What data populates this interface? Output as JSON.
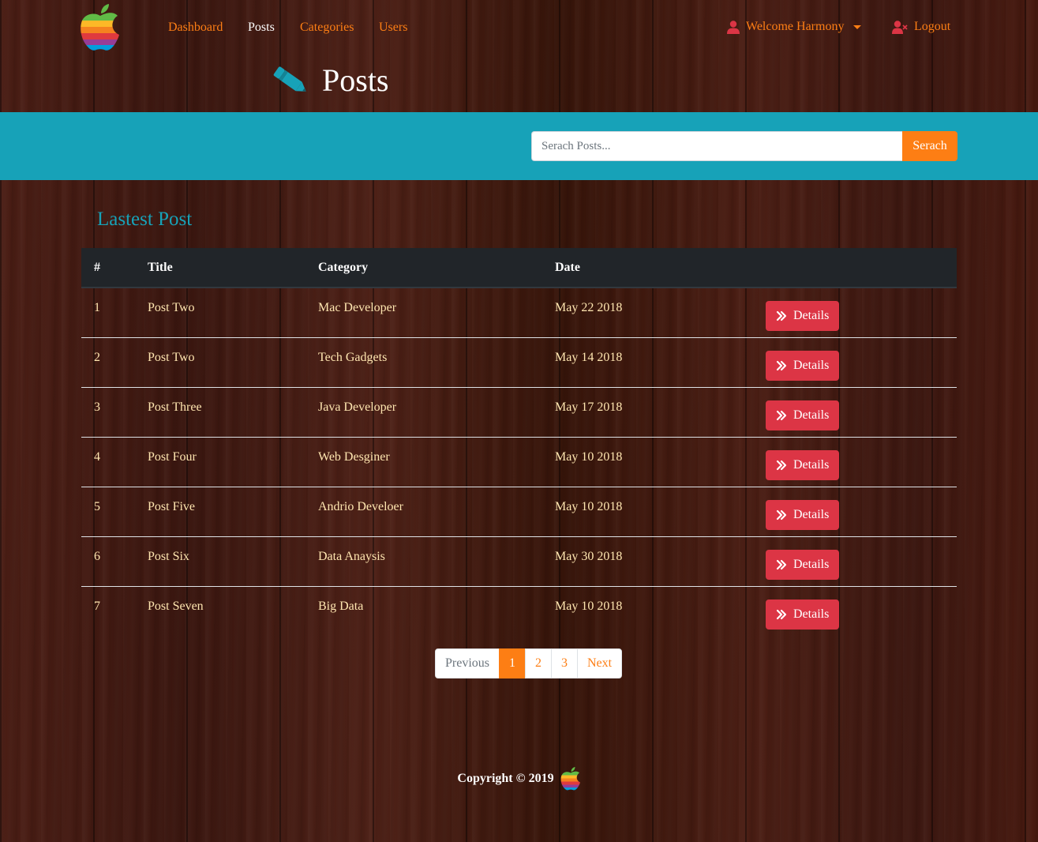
{
  "nav": {
    "links": [
      "Dashboard",
      "Posts",
      "Categories",
      "Users"
    ],
    "active": "Posts",
    "welcome": "Welcome Harmony",
    "logout": "Logout"
  },
  "header": {
    "title": "Posts"
  },
  "search": {
    "placeholder": "Serach Posts...",
    "button": "Serach"
  },
  "latest": {
    "title": "Lastest Post",
    "columns": [
      "#",
      "Title",
      "Category",
      "Date",
      ""
    ],
    "rows": [
      {
        "num": "1",
        "title": "Post Two",
        "category": "Mac Developer",
        "date": "May 22 2018",
        "action": "Details"
      },
      {
        "num": "2",
        "title": "Post Two",
        "category": "Tech Gadgets",
        "date": "May 14 2018",
        "action": "Details"
      },
      {
        "num": "3",
        "title": "Post Three",
        "category": "Java Developer",
        "date": "May 17 2018",
        "action": "Details"
      },
      {
        "num": "4",
        "title": "Post Four",
        "category": "Web Desginer",
        "date": "May 10 2018",
        "action": "Details"
      },
      {
        "num": "5",
        "title": "Post Five",
        "category": "Andrio Develoer",
        "date": "May 10 2018",
        "action": "Details"
      },
      {
        "num": "6",
        "title": "Post Six",
        "category": "Data Anaysis",
        "date": "May 30 2018",
        "action": "Details"
      },
      {
        "num": "7",
        "title": "Post Seven",
        "category": "Big Data",
        "date": "May 10 2018",
        "action": "Details"
      }
    ]
  },
  "pagination": {
    "items": [
      "Previous",
      "1",
      "2",
      "3",
      "Next"
    ],
    "active": "1"
  },
  "footer": {
    "text": "Copyright © 2019"
  },
  "colors": {
    "accent": "#fd7e14",
    "teal": "#17a2b8",
    "danger": "#dc3545",
    "dark": "#212529"
  },
  "icons": {
    "logo": "apple-logo-icon",
    "user": "user-icon",
    "logout": "user-times-icon",
    "pencil": "pencil-icon",
    "details": "angle-double-right-icon"
  }
}
